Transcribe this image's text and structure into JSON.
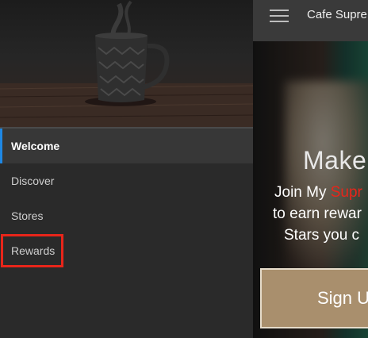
{
  "app": {
    "title": "Cafe Supre"
  },
  "nav": {
    "items": [
      {
        "label": "Welcome",
        "active": true
      },
      {
        "label": "Discover",
        "active": false
      },
      {
        "label": "Stores",
        "active": false
      },
      {
        "label": "Rewards",
        "active": false,
        "highlighted": true
      }
    ]
  },
  "promo": {
    "heading": "Make",
    "line1_prefix": "Join My ",
    "line1_brand": "Supr",
    "line2": "to earn rewar",
    "line3": "Stars you c",
    "signup_label": "Sign U"
  },
  "colors": {
    "accent": "#1e88e5",
    "highlight": "#e8251a",
    "brand_red": "#e8251a",
    "signup_bg": "#a98f6d"
  },
  "icons": {
    "menu": "hamburger-menu-icon"
  }
}
